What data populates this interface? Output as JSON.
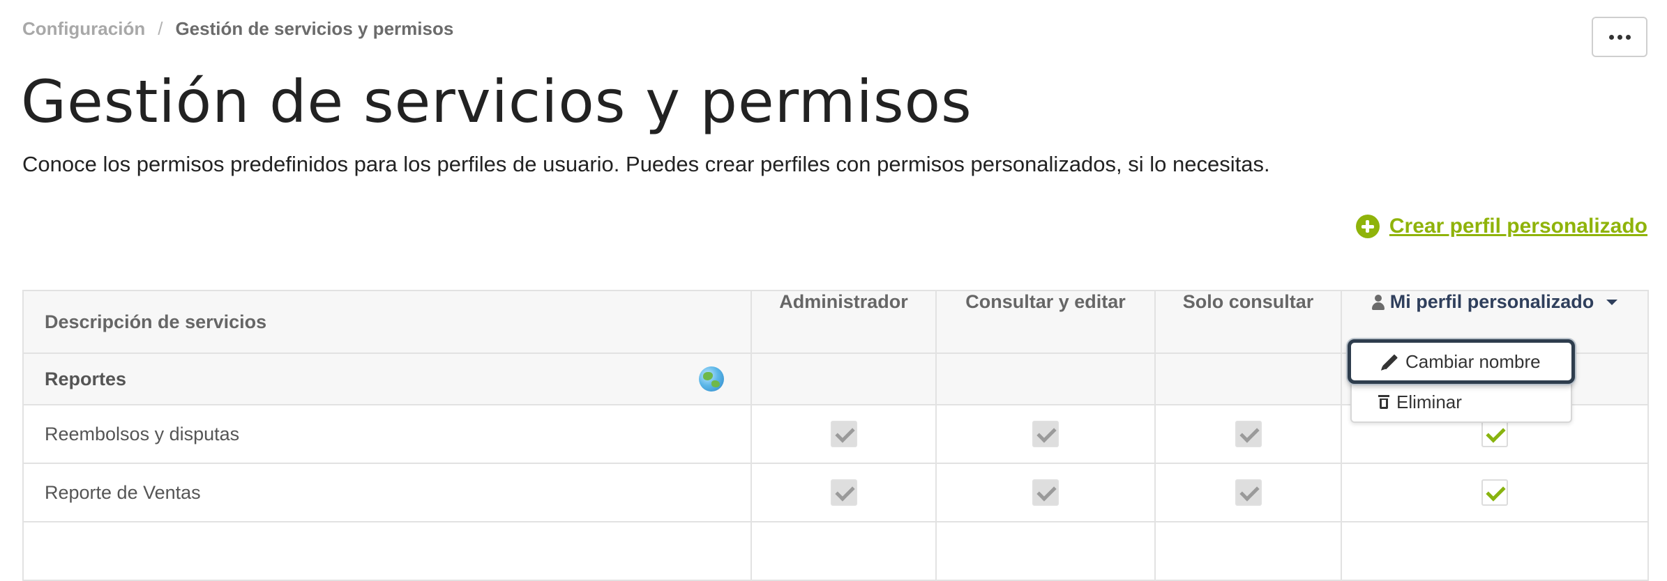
{
  "breadcrumb": {
    "parent": "Configuración",
    "separator": "/",
    "current": "Gestión de servicios y permisos"
  },
  "header": {
    "title": "Gestión de servicios y permisos",
    "subtitle": "Conoce los permisos predefinidos para los perfiles de usuario. Puedes crear perfiles con permisos personalizados, si lo necesitas.",
    "create_link": "Crear perfil personalizado",
    "more_icon": "ellipsis-icon"
  },
  "colors": {
    "accent": "#8fb30a",
    "check_active": "#88b30f",
    "check_inactive": "#9a9a9a"
  },
  "table": {
    "columns": {
      "description": "Descripción de servicios",
      "admin": "Administrador",
      "edit": "Consultar y editar",
      "view": "Solo consultar",
      "custom": "Mi perfil personalizado"
    },
    "group": "Reportes",
    "rows": [
      {
        "label": "Reembolsos y disputas",
        "admin": true,
        "edit": true,
        "view": true,
        "custom": true
      },
      {
        "label": "Reporte de Ventas",
        "admin": true,
        "edit": true,
        "view": true,
        "custom": true
      }
    ]
  },
  "dropdown": {
    "rename": "Cambiar nombre",
    "delete": "Eliminar"
  }
}
